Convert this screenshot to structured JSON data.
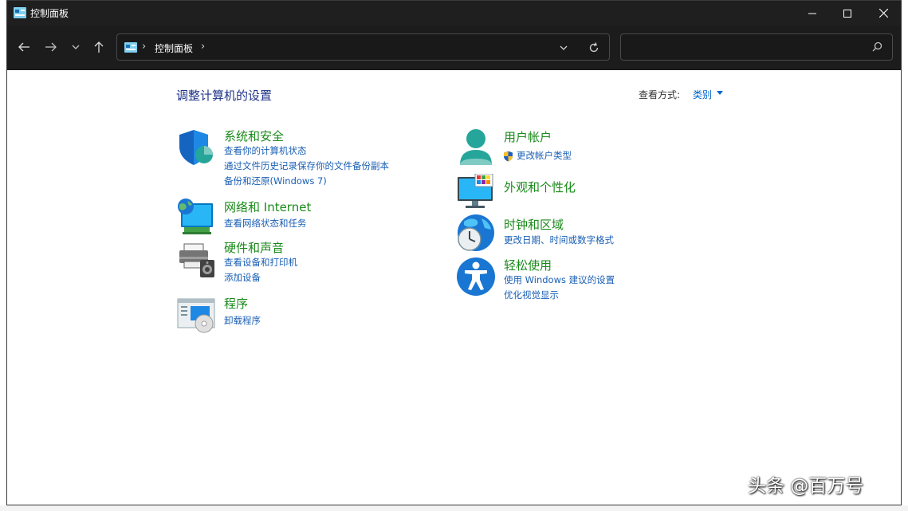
{
  "window": {
    "title": "控制面板"
  },
  "address": {
    "path": "控制面板",
    "search_placeholder": ""
  },
  "content": {
    "heading": "调整计算机的设置",
    "view_label": "查看方式:",
    "view_value": "类别"
  },
  "categories": {
    "system": {
      "title": "系统和安全",
      "links": [
        "查看你的计算机状态",
        "通过文件历史记录保存你的文件备份副本",
        "备份和还原(Windows 7)"
      ]
    },
    "network": {
      "title": "网络和 Internet",
      "links": [
        "查看网络状态和任务"
      ]
    },
    "hardware": {
      "title": "硬件和声音",
      "links": [
        "查看设备和打印机",
        "添加设备"
      ]
    },
    "programs": {
      "title": "程序",
      "links": [
        "卸载程序"
      ]
    },
    "users": {
      "title": "用户帐户",
      "links": [
        "更改帐户类型"
      ]
    },
    "appearance": {
      "title": "外观和个性化",
      "links": []
    },
    "clock": {
      "title": "时钟和区域",
      "links": [
        "更改日期、时间或数字格式"
      ]
    },
    "ease": {
      "title": "轻松使用",
      "links": [
        "使用 Windows 建议的设置",
        "优化视觉显示"
      ]
    }
  },
  "watermark": "头条 @百万号",
  "colors": {
    "title_green": "#1a8a1a",
    "link_blue": "#1a5fb4",
    "heading_blue": "#1e3287",
    "titlebar": "#1f1f1f"
  }
}
